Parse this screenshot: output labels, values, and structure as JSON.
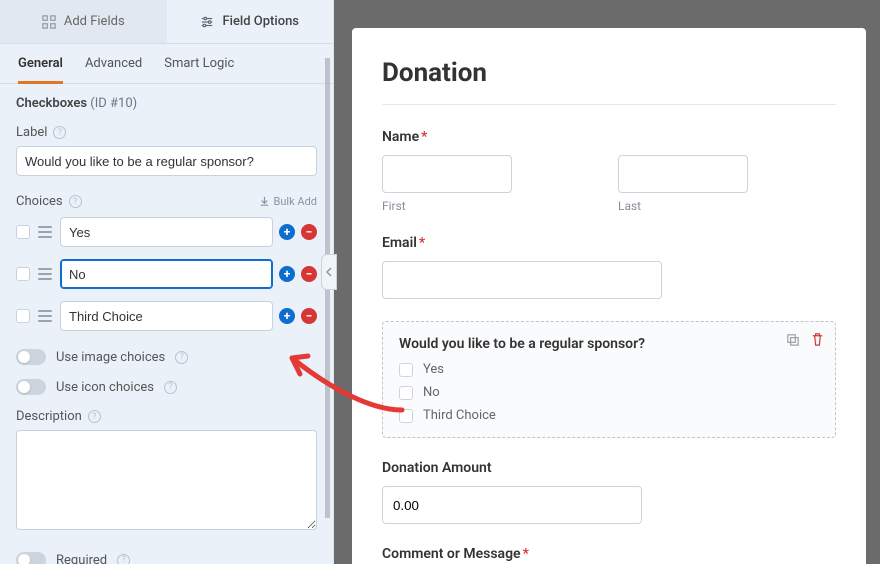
{
  "panel": {
    "tabs": {
      "add_fields": "Add Fields",
      "field_options": "Field Options"
    },
    "subtabs": {
      "general": "General",
      "advanced": "Advanced",
      "smart_logic": "Smart Logic"
    },
    "field_type": "Checkboxes",
    "field_id": "(ID #10)",
    "labels": {
      "label": "Label",
      "choices": "Choices",
      "bulk_add": "Bulk Add",
      "use_image": "Use image choices",
      "use_icon": "Use icon choices",
      "description": "Description",
      "required": "Required"
    },
    "label_value": "Would you like to be a regular sponsor?",
    "choices": [
      "Yes",
      "No",
      "Third Choice"
    ]
  },
  "form": {
    "title": "Donation",
    "name": {
      "label": "Name",
      "first": "First",
      "last": "Last"
    },
    "email": {
      "label": "Email"
    },
    "sponsor": {
      "label": "Would you like to be a regular sponsor?",
      "options": [
        "Yes",
        "No",
        "Third Choice"
      ]
    },
    "amount": {
      "label": "Donation Amount",
      "value": "0.00"
    },
    "comment": {
      "label": "Comment or Message"
    }
  }
}
